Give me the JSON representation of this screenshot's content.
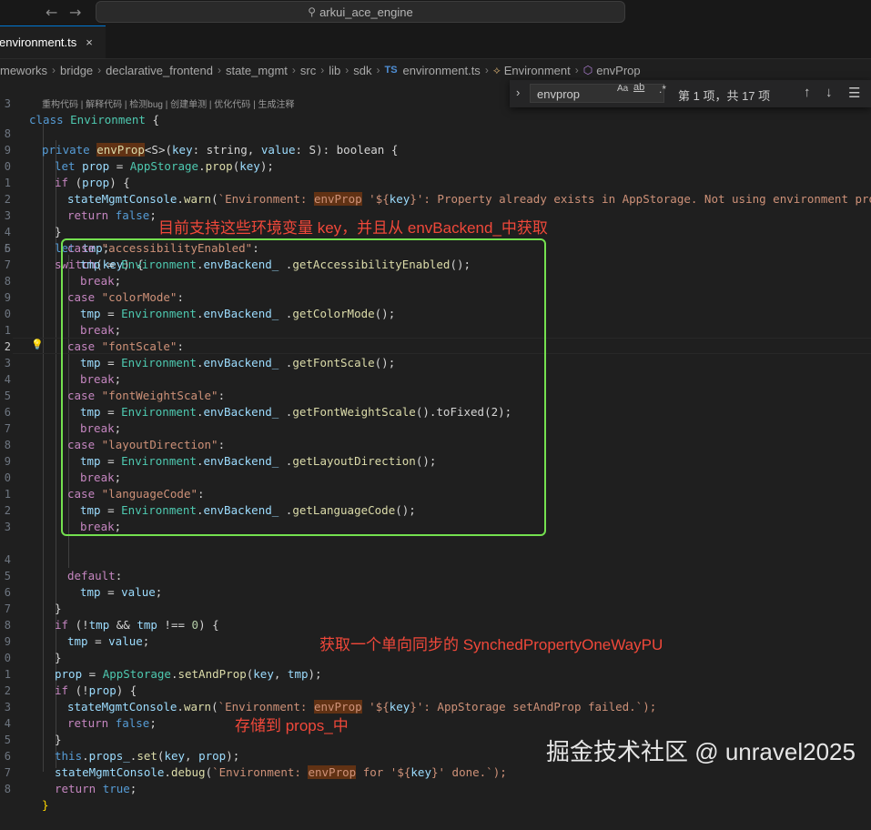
{
  "window": {
    "command_center": "arkui_ace_engine",
    "back_icon": "arrow-left-icon",
    "forward_icon": "arrow-right-icon"
  },
  "tab": {
    "label": "environment.ts",
    "close": "×"
  },
  "breadcrumb": [
    "meworks",
    "bridge",
    "declarative_frontend",
    "state_mgmt",
    "src",
    "lib",
    "sdk"
  ],
  "breadcrumb_file": "environment.ts",
  "breadcrumb_ts": "TS",
  "breadcrumb_symbols": [
    "Environment",
    "envProp"
  ],
  "find": {
    "query": "envprop",
    "match_case": "Aa",
    "whole_word": "ab",
    "regex": ".*",
    "result": "第 1 项，共 17 项"
  },
  "codelens": "重构代码 | 解释代码 | 检测bug | 创建单测 | 优化代码 | 生成注释",
  "line_numbers": [
    "3",
    "",
    "8",
    "9",
    "0",
    "1",
    "2",
    "3",
    "4",
    "5",
    "6",
    "7",
    "8",
    "9",
    "0",
    "1",
    "2",
    "3",
    "4",
    "5",
    "6",
    "7",
    "8",
    "9",
    "0",
    "1",
    "2",
    "3",
    "4",
    "5",
    "6",
    "7",
    "8",
    "9",
    "0",
    "1",
    "2",
    "3",
    "4",
    "5",
    "6",
    "7",
    "8",
    "9",
    "0",
    "1",
    "2",
    "3",
    "4",
    "5",
    "6",
    "7",
    "8",
    "9",
    "0",
    "1",
    "2",
    "3",
    "4",
    "5",
    "6",
    "7",
    "8",
    "9",
    "0",
    "1",
    "2",
    "3",
    "4",
    "5",
    "6",
    "7",
    "8"
  ],
  "code": {
    "l3_a": "class ",
    "l3_b": "Environment",
    "l3_c": " {",
    "l8_a": "private ",
    "l8_b": "envProp",
    "l8_c": "<S>(",
    "l8_d": "key",
    "l8_e": ": string, ",
    "l8_f": "value",
    "l8_g": ": S): boolean {",
    "l9_a": "let ",
    "l9_b": "prop",
    "l9_c": " = ",
    "l9_d": "AppStorage",
    "l9_e": ".",
    "l9_f": "prop",
    "l9_g": "(",
    "l9_h": "key",
    "l9_i": ");",
    "l10_a": "if ",
    "l10_b": "(",
    "l10_c": "prop",
    "l10_d": ") {",
    "l11_a": "stateMgmtConsole",
    "l11_b": ".",
    "l11_c": "warn",
    "l11_d": "(",
    "l11_e": "`Environment: ",
    "l11_f": "envProp",
    "l11_g": " '${",
    "l11_h": "key",
    "l11_i": "}': Property already exists in AppStorage. Not using environment property",
    "l12_a": "return ",
    "l12_b": "false",
    "l12_c": ";",
    "l13": "}",
    "l14_a": "let ",
    "l14_b": "tmp",
    "l14_c": ";",
    "l15_a": "switch",
    "l15_b": "(",
    "l15_c": "key",
    "l15_d": ") {",
    "cases": [
      {
        "label": "\"accessibilityEnabled\"",
        "getter": "getAccessibilityEnabled",
        "tail": "();"
      },
      {
        "label": "\"colorMode\"",
        "getter": "getColorMode",
        "tail": "();"
      },
      {
        "label": "\"fontScale\"",
        "getter": "getFontScale",
        "tail": "();"
      },
      {
        "label": "\"fontWeightScale\"",
        "getter": "getFontWeightScale",
        "tail": "().toFixed(2);"
      },
      {
        "label": "\"layoutDirection\"",
        "getter": "getLayoutDirection",
        "tail": "();"
      },
      {
        "label": "\"languageCode\"",
        "getter": "getLanguageCode",
        "tail": "();"
      }
    ],
    "case_kw": "case ",
    "colon": ":",
    "tmp_assign_a": "tmp",
    "tmp_assign_b": " = ",
    "tmp_assign_c": "Environment",
    "tmp_assign_d": ".",
    "tmp_assign_e": "envBackend_",
    "tmp_assign_f": " .",
    "break_kw": "break",
    "semi": ";",
    "default_kw": "default",
    "l_defval_a": "tmp",
    "l_defval_b": " = ",
    "l_defval_c": "value",
    "l_defval_d": ";",
    "close_brace": "}",
    "l_if2_a": "if ",
    "l_if2_b": "(!",
    "l_if2_c": "tmp",
    "l_if2_d": " && ",
    "l_if2_e": "tmp",
    "l_if2_f": " !== ",
    "l_if2_g": "0",
    "l_if2_h": ") {",
    "l_set_a": "prop",
    "l_set_b": " = ",
    "l_set_c": "AppStorage",
    "l_set_d": ".",
    "l_set_e": "setAndProp",
    "l_set_f": "(",
    "l_set_g": "key",
    "l_set_h": ", ",
    "l_set_i": "tmp",
    "l_set_j": ");",
    "l_if3_a": "if ",
    "l_if3_b": "(!",
    "l_if3_c": "prop",
    "l_if3_d": ") {",
    "l_warn2_a": "stateMgmtConsole",
    "l_warn2_b": ".",
    "l_warn2_c": "warn",
    "l_warn2_d": "(",
    "l_warn2_e": "`Environment: ",
    "l_warn2_f": "envProp",
    "l_warn2_g": " '${",
    "l_warn2_h": "key",
    "l_warn2_i": "}': AppStorage setAndProp failed.`);",
    "l_props_a": "this",
    "l_props_b": ".",
    "l_props_c": "props_",
    "l_props_d": ".",
    "l_props_e": "set",
    "l_props_f": "(",
    "l_props_g": "key",
    "l_props_h": ", ",
    "l_props_i": "prop",
    "l_props_j": ");",
    "l_debug_a": "stateMgmtConsole",
    "l_debug_b": ".",
    "l_debug_c": "debug",
    "l_debug_d": "(",
    "l_debug_e": "`Environment: ",
    "l_debug_f": "envProp",
    "l_debug_g": " for '${",
    "l_debug_h": "key",
    "l_debug_i": "}' done.`);",
    "l_ret_a": "return ",
    "l_ret_b": "true",
    "l_ret_c": ";"
  },
  "annotations": {
    "switch_note": "目前支持这些环境变量 key，并且从 envBackend_中获取",
    "setandprop_note": "获取一个单向同步的 SynchedPropertyOneWayPU",
    "props_note": "存储到 props_中"
  },
  "watermark": "掘金技术社区 @ unravel2025",
  "colors": {
    "annotation": "#f0483a",
    "box": "#74e04f",
    "accent": "#0078d4"
  }
}
